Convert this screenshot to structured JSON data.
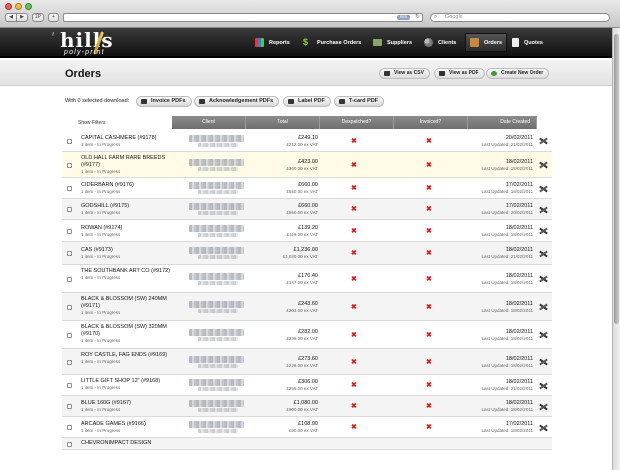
{
  "browser": {
    "tab_button_label": "1P",
    "new_tab_label": "+",
    "search_placeholder": "Google",
    "rss_label": "RSS"
  },
  "nav": {
    "logo": "hills",
    "logo_sub": "poly-print",
    "logo_prefix": "the",
    "items": [
      {
        "label": "Reports",
        "icon": "bar-chart-icon"
      },
      {
        "label": "Purchase Orders",
        "icon": "dollar-icon"
      },
      {
        "label": "Suppliers",
        "icon": "truck-icon"
      },
      {
        "label": "Clients",
        "icon": "people-icon"
      },
      {
        "label": "Orders",
        "icon": "box-icon",
        "active": true
      },
      {
        "label": "Quotes",
        "icon": "document-icon"
      }
    ]
  },
  "page": {
    "title": "Orders",
    "view_csv": "View as CSV",
    "view_pdf": "View as PDF",
    "create_new": "Create New Order",
    "download_label": "With 0 selected download:",
    "downloads": [
      "Invoice PDFs",
      "Acknowledgement PDFs",
      "Label PDF",
      "T-card PDF"
    ],
    "show_filters": "Show Filters"
  },
  "table": {
    "columns": [
      "Client",
      "Total",
      "Despatched?",
      "Invoiced?",
      "Date Created"
    ],
    "rows": [
      {
        "name": "CAPITAL CASHMERE (#9178)",
        "status": "1 item - In Progress",
        "total": "£249.10",
        "ex_vat": "£212.00 ex VAT",
        "date": "20/02/2011",
        "updated": "Last Updated: 21/02/2011"
      },
      {
        "name": "OLD HALL FARM RARE BREEDS (#9177)",
        "status": "1 item - In Progress",
        "total": "£423.00",
        "ex_vat": "£360.00 ex VAT",
        "date": "18/02/2011",
        "updated": "Last Updated: 18/02/2011"
      },
      {
        "name": "CIDERBARN (#9176)",
        "status": "1 item - In Progress",
        "total": "£660.00",
        "ex_vat": "£550.00 ex VAT",
        "date": "17/02/2011",
        "updated": "Last Updated: 18/02/2011"
      },
      {
        "name": "GODSHILL (#9175)",
        "status": "1 item - In Progress",
        "total": "£660.00",
        "ex_vat": "£550.00 ex VAT",
        "date": "17/02/2011",
        "updated": "Last Updated: 20/02/2011"
      },
      {
        "name": "ROWAN (#9174)",
        "status": "1 item - In Progress",
        "total": "£139.20",
        "ex_vat": "£116.00 ex VAT",
        "date": "18/02/2011",
        "updated": "Last Updated: 18/02/2011"
      },
      {
        "name": "CAS (#9173)",
        "status": "1 item - In Progress",
        "total": "£1,236.00",
        "ex_vat": "£1,030.00 ex VAT",
        "date": "18/02/2011",
        "updated": "Last Updated: 21/02/2011"
      },
      {
        "name": "THE SOUTHBANK ART CO (#9172)",
        "status": "1 item - In Progress",
        "total": "£176.40",
        "ex_vat": "£147.00 ex VAT",
        "date": "18/02/2011",
        "updated": "Last Updated: 18/02/2011"
      },
      {
        "name": "BLACK & BLOSSOM (SW) 240MM (#9171)",
        "status": "1 item - In Progress",
        "total": "£243.60",
        "ex_vat": "£203.00 ex VAT",
        "date": "18/02/2011",
        "updated": "Last Updated: 18/02/2011"
      },
      {
        "name": "BLACK & BLOSSOM (SW) 320MM (#9170)",
        "status": "1 item - In Progress",
        "total": "£282.00",
        "ex_vat": "£235.00 ex VAT",
        "date": "18/02/2011",
        "updated": "Last Updated: 18/02/2011"
      },
      {
        "name": "ROY CASTLE, FAG ENDS (#9169)",
        "status": "1 item - In Progress",
        "total": "£273.60",
        "ex_vat": "£228.00 ex VAT",
        "date": "18/02/2011",
        "updated": "Last Updated: 18/02/2011"
      },
      {
        "name": "LITTLE GIFT SHOP 12\" (#9168)",
        "status": "1 item - In Progress",
        "total": "£306.00",
        "ex_vat": "£255.00 ex VAT",
        "date": "18/02/2011",
        "updated": "Last Updated: 21/02/2011"
      },
      {
        "name": "BLUE 160G (#9167)",
        "status": "1 item - In Progress",
        "total": "£1,080.00",
        "ex_vat": "£900.00 ex VAT",
        "date": "18/02/2011",
        "updated": "Last Updated: 18/02/2011"
      },
      {
        "name": "ARCADE GAMES (#9166)",
        "status": "1 item - In Progress",
        "total": "£108.00",
        "ex_vat": "£90.00 ex VAT",
        "date": "17/02/2011",
        "updated": "Last Updated: 18/02/2011"
      },
      {
        "name": "CHEVRONIMPACT DESIGN",
        "status": "",
        "total": "",
        "ex_vat": "",
        "date": "",
        "updated": ""
      }
    ]
  },
  "colors": {
    "nav_bg": "#1a1a1a",
    "header_th": "#7b7b7b",
    "cross": "#d0231e",
    "highlight_row": "#fffbe6"
  }
}
